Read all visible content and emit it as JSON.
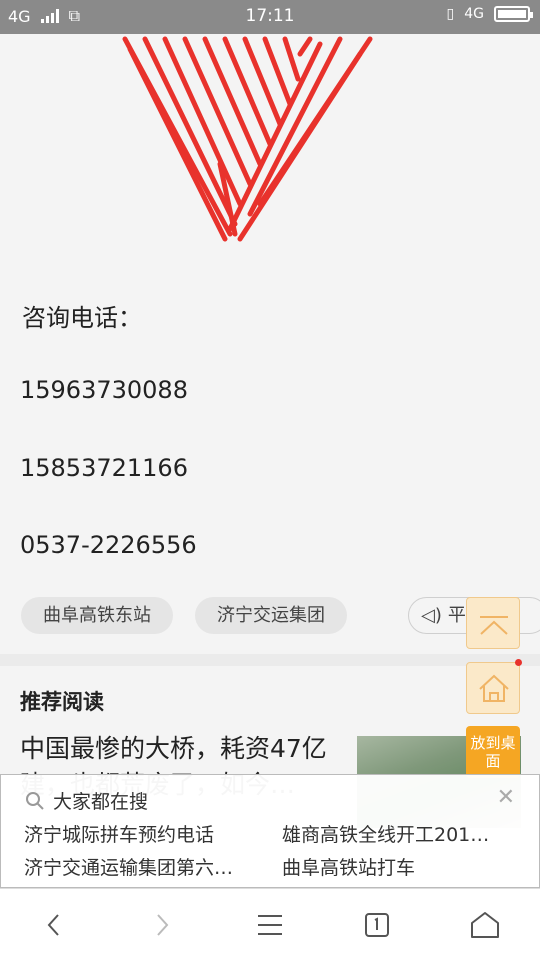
{
  "status_bar": {
    "network": "4G",
    "time": "17:11",
    "right_network": "4G"
  },
  "content": {
    "consult_label": "咨询电话：",
    "phones": [
      "15963730088",
      "15853721166",
      "0537-2226556"
    ],
    "tags": [
      "曲阜高铁东站",
      "济宁交运集团",
      "平台"
    ],
    "recommend_title": "推荐阅读",
    "article_title": "中国最惨的大桥，耗资47亿建，也都荒废了，如今…"
  },
  "side_buttons": {
    "to_desktop": "放到桌面"
  },
  "search_panel": {
    "title": "大家都在搜",
    "keywords": [
      "济宁城际拼车预约电话",
      "雄商高铁全线开工201…",
      "济宁交通运输集团第六…",
      "曲阜高铁站打车"
    ]
  },
  "colors": {
    "accent_orange": "#f5a623",
    "heart_red": "#e8322c",
    "status_bar": "#8a8a8a"
  }
}
